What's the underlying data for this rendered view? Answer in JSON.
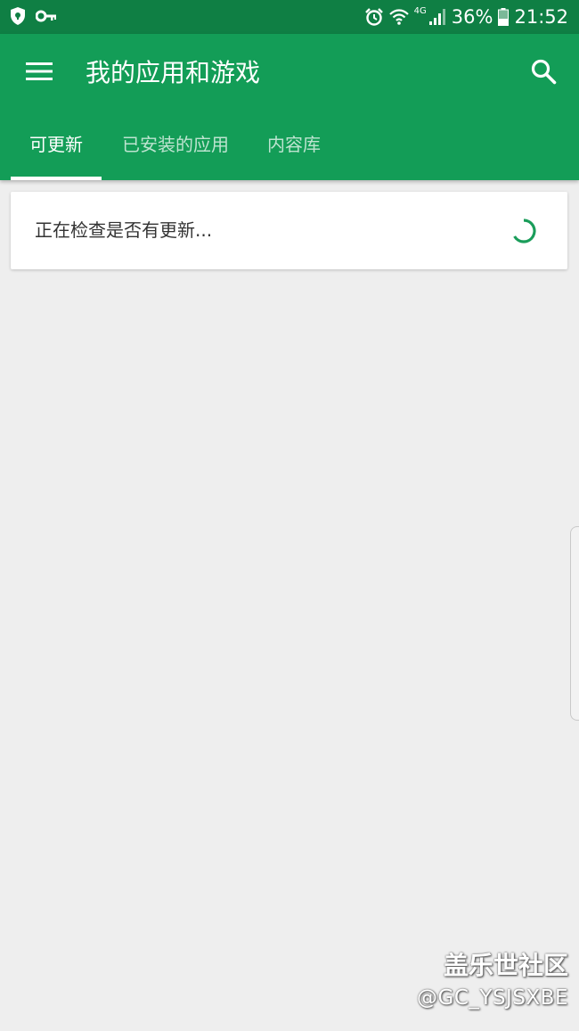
{
  "status_bar": {
    "battery": "36%",
    "time": "21:52",
    "network": "4G",
    "icons": [
      "shield-icon",
      "key-icon",
      "alarm-icon",
      "wifi-icon",
      "signal-icon",
      "battery-icon"
    ]
  },
  "app_bar": {
    "title": "我的应用和游戏",
    "menu_icon": "menu-icon",
    "search_icon": "search-icon",
    "background_color": "#139d57",
    "status_bar_color": "#0f7f44"
  },
  "tabs": [
    {
      "label": "可更新",
      "selected": true
    },
    {
      "label": "已安装的应用",
      "selected": false
    },
    {
      "label": "内容库",
      "selected": false
    }
  ],
  "update_card": {
    "message": "正在检查是否有更新...",
    "spinner_color": "#1a9d5a"
  },
  "watermark": {
    "brand": "盖乐世社区",
    "user": "@GC_YSJSXBE"
  }
}
